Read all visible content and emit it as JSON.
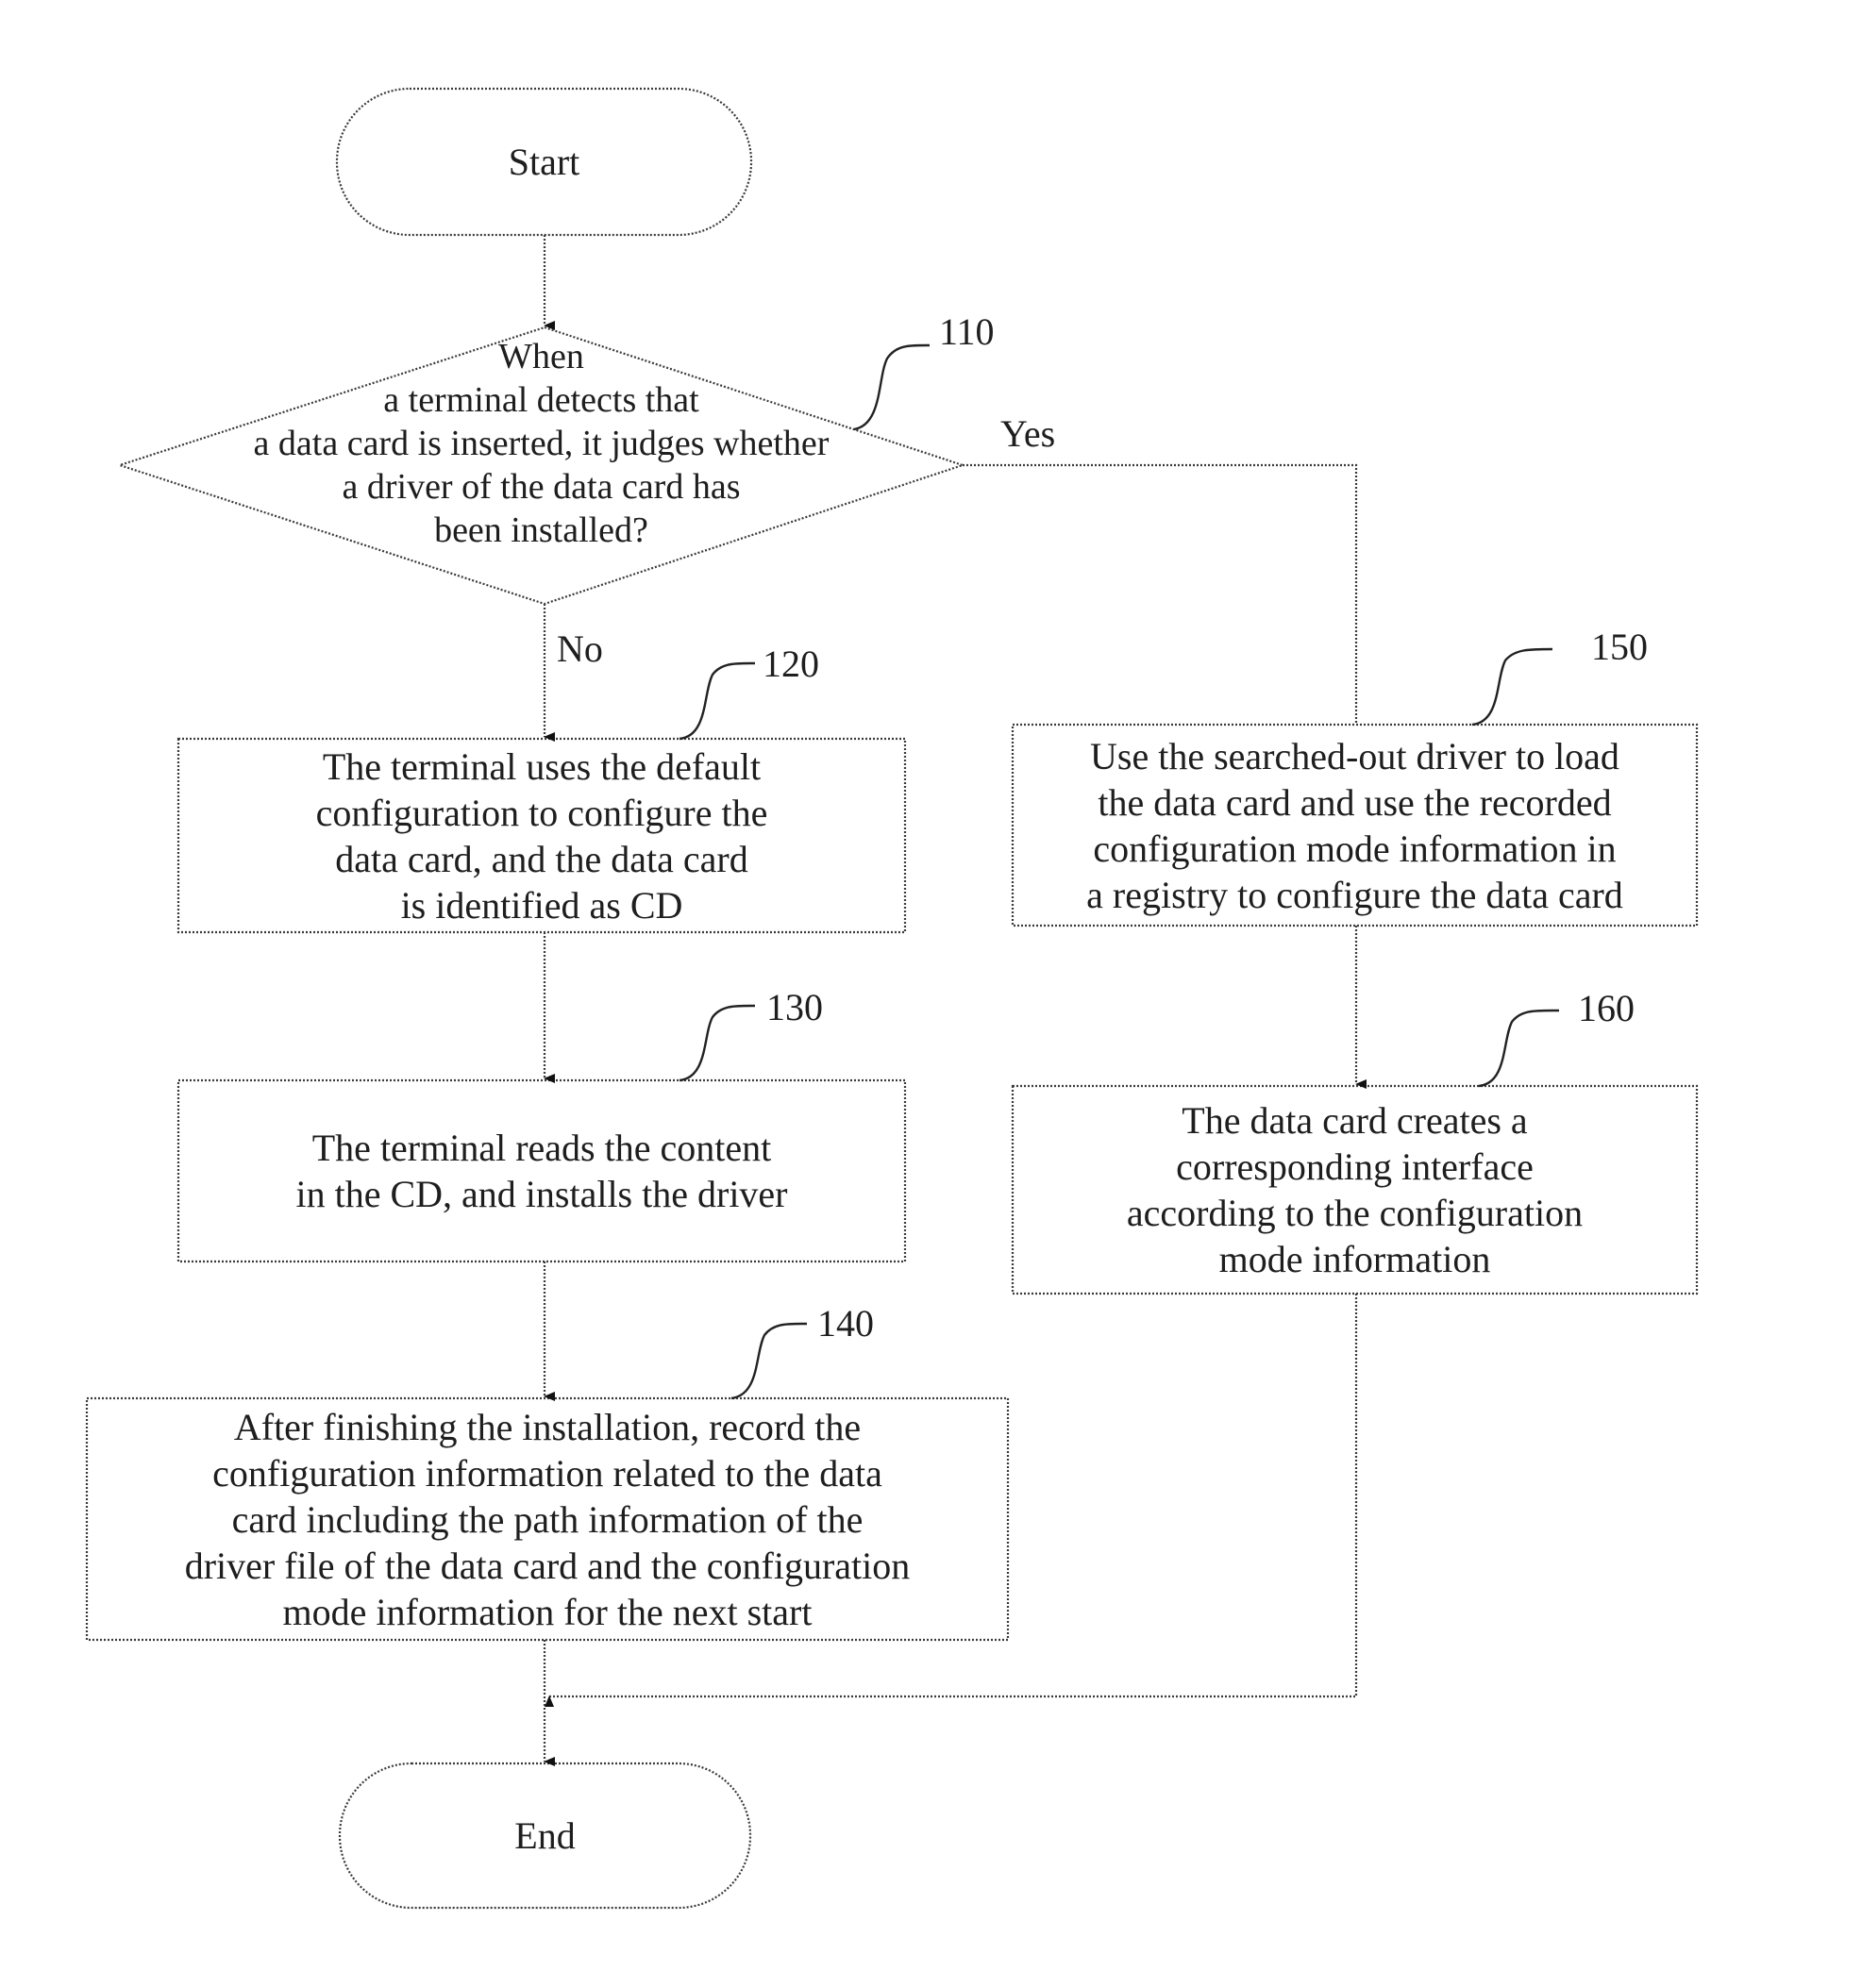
{
  "diagram": {
    "type": "flowchart",
    "nodes": [
      {
        "id": "start",
        "shape": "terminator",
        "text": "Start"
      },
      {
        "id": "110",
        "shape": "decision",
        "ref": "110",
        "text": "When\na terminal detects that\na data card is inserted, it judges whether\na driver of the data card has\nbeen installed?"
      },
      {
        "id": "120",
        "shape": "process",
        "ref": "120",
        "text": "The terminal uses the default\nconfiguration to configure the\ndata card, and the data card\nis identified as CD"
      },
      {
        "id": "130",
        "shape": "process",
        "ref": "130",
        "text": "The terminal reads the content\nin the CD, and installs the driver"
      },
      {
        "id": "140",
        "shape": "process",
        "ref": "140",
        "text": "After finishing the installation, record the\nconfiguration information related to the data\ncard including the path information of the\ndriver file of the data card and the configuration\nmode information for the next start"
      },
      {
        "id": "150",
        "shape": "process",
        "ref": "150",
        "text": "Use the searched-out driver to load\nthe data card and use the recorded\nconfiguration mode information in\na registry to configure the data card"
      },
      {
        "id": "160",
        "shape": "process",
        "ref": "160",
        "text": "The data card creates a\ncorresponding interface\naccording to the configuration\nmode information"
      },
      {
        "id": "end",
        "shape": "terminator",
        "text": "End"
      }
    ],
    "edges": [
      {
        "from": "start",
        "to": "110",
        "label": ""
      },
      {
        "from": "110",
        "to": "120",
        "label": "No"
      },
      {
        "from": "110",
        "to": "150",
        "label": "Yes"
      },
      {
        "from": "120",
        "to": "130",
        "label": ""
      },
      {
        "from": "130",
        "to": "140",
        "label": ""
      },
      {
        "from": "140",
        "to": "end",
        "label": ""
      },
      {
        "from": "150",
        "to": "160",
        "label": ""
      },
      {
        "from": "160",
        "to": "end",
        "label": ""
      }
    ],
    "branch_labels": {
      "yes": "Yes",
      "no": "No"
    },
    "ref_labels": {
      "r110": "110",
      "r120": "120",
      "r130": "130",
      "r140": "140",
      "r150": "150",
      "r160": "160"
    },
    "line_color": "#3a3a3a",
    "background": "#ffffff"
  }
}
